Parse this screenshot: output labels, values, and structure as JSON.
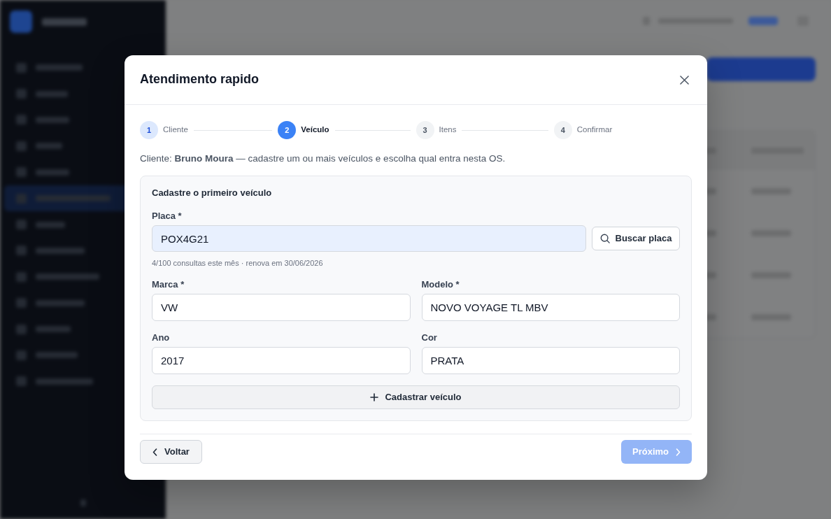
{
  "modal": {
    "title": "Atendimento rapido"
  },
  "steps": [
    {
      "number": "1",
      "label": "Cliente",
      "done": true,
      "selected": false
    },
    {
      "number": "2",
      "label": "Veículo",
      "done": false,
      "selected": true
    },
    {
      "number": "3",
      "label": "Itens",
      "done": false,
      "selected": false
    },
    {
      "number": "4",
      "label": "Confirmar",
      "done": false,
      "selected": false
    }
  ],
  "intro": "Cliente: **Bruno Moura** — cadastre um ou mais veículos e escolha qual entra nesta OS.",
  "vehicle_form": {
    "title": "Cadastre o primeiro veículo",
    "plate": {
      "label": "Placa *",
      "value": "POX4G21",
      "autofilled": true
    },
    "lookup_button": "Buscar placa",
    "quota_hint": "4/100 consultas este mês · renova em 30/06/2026",
    "fields": [
      {
        "label": "Marca *",
        "value": "VW"
      },
      {
        "label": "Modelo *",
        "value": "NOVO VOYAGE TL MBV"
      },
      {
        "label": "Ano",
        "value": "2017"
      },
      {
        "label": "Cor",
        "value": "PRATA"
      }
    ],
    "add_button": "Cadastrar veículo"
  },
  "footer": {
    "back_button": "Voltar",
    "next_button": {
      "label": "Próximo",
      "disabled": true
    }
  }
}
